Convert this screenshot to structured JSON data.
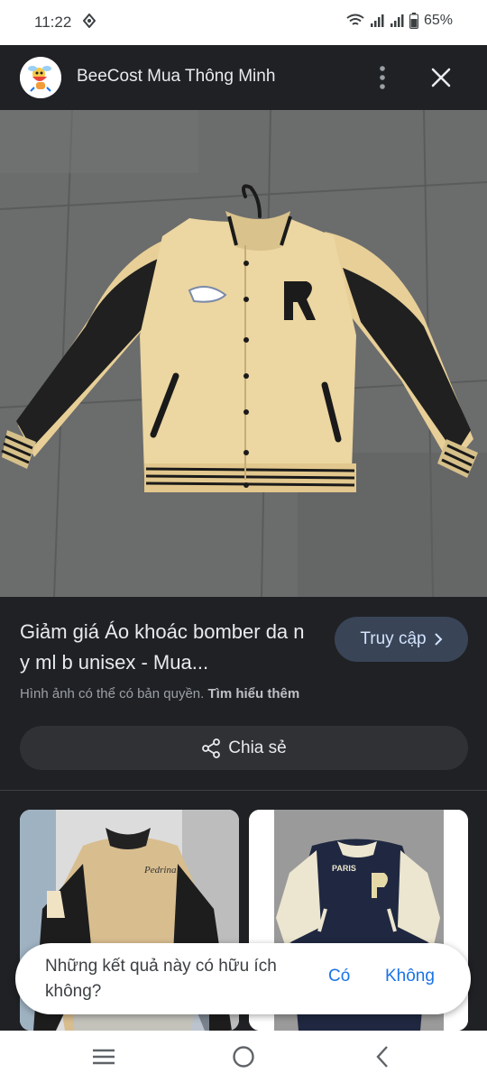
{
  "status": {
    "time": "11:22",
    "battery": "65%",
    "icons": [
      "vpn-key-icon",
      "wifi-icon",
      "signal-icon",
      "signal-icon-2",
      "battery-icon"
    ]
  },
  "header": {
    "title": "BeeCost Mua Thông Minh",
    "icons": [
      "beecost-logo",
      "more-vert-icon",
      "close-icon"
    ]
  },
  "result": {
    "title": "Giảm giá Áo khoác bomber da n y ml b unisex - Mua...",
    "visit_label": "Truy cập",
    "copyright_text": "Hình ảnh có thể có bản quyền.",
    "learn_more": "Tìm hiểu thêm",
    "share_label": "Chia sẻ"
  },
  "feedback": {
    "question": "Những kết quả này có hữu ích không?",
    "yes": "Có",
    "no": "Không"
  },
  "nav": {
    "icons": [
      "recent-apps-icon",
      "home-icon",
      "back-icon"
    ]
  },
  "colors": {
    "background": "#202124",
    "visit_button": "#394457",
    "link": "#1a73e8"
  }
}
